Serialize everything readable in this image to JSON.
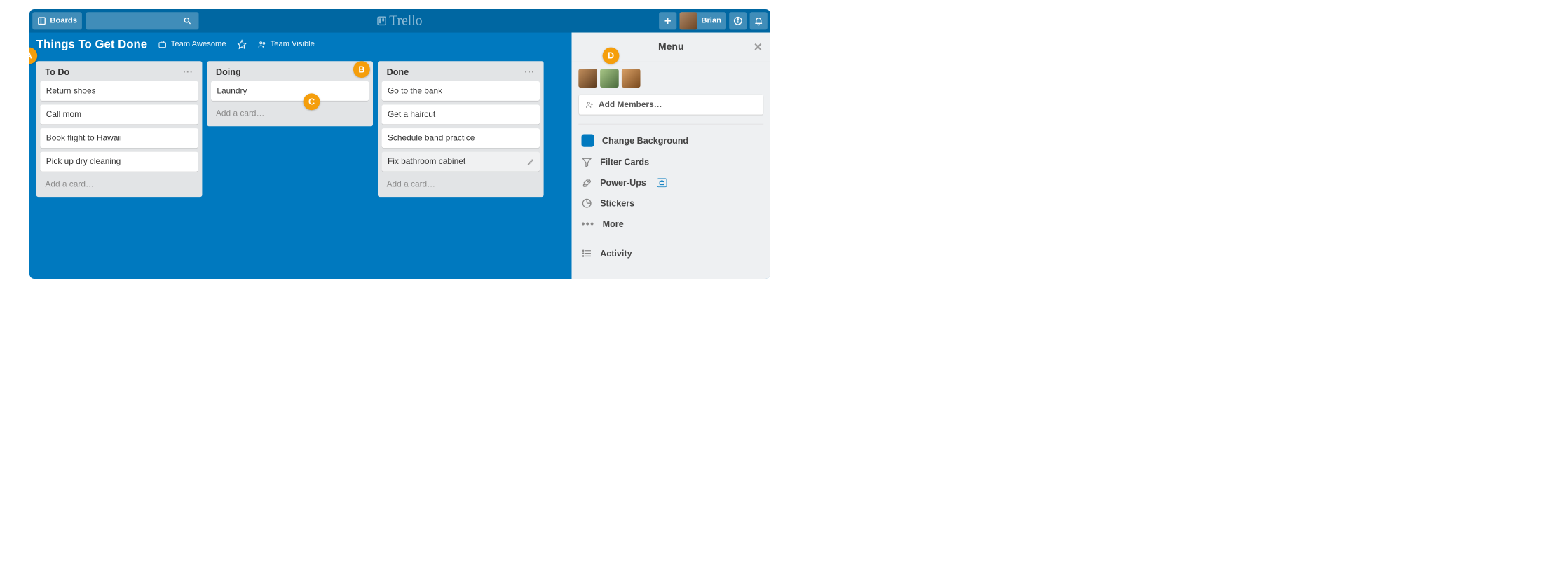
{
  "header": {
    "boards_label": "Boards",
    "user_name": "Brian",
    "logo_text": "Trello"
  },
  "board": {
    "title": "Things To Get Done",
    "team_label": "Team Awesome",
    "visibility_label": "Team Visible"
  },
  "lists": [
    {
      "title": "To Do",
      "cards": [
        "Return shoes",
        "Call mom",
        "Book flight to Hawaii",
        "Pick up dry cleaning"
      ],
      "add_label": "Add a card…"
    },
    {
      "title": "Doing",
      "cards": [
        "Laundry"
      ],
      "add_label": "Add a card…"
    },
    {
      "title": "Done",
      "cards": [
        "Go to the bank",
        "Get a haircut",
        "Schedule band practice",
        "Fix bathroom cabinet"
      ],
      "hover_index": 3,
      "add_label": "Add a card…"
    }
  ],
  "menu": {
    "title": "Menu",
    "add_members_label": "Add Members…",
    "items": {
      "change_bg": "Change Background",
      "filter": "Filter Cards",
      "powerups": "Power-Ups",
      "stickers": "Stickers",
      "more": "More",
      "activity": "Activity"
    }
  },
  "callouts": {
    "a": "A",
    "b": "B",
    "c": "C",
    "d": "D"
  },
  "colors": {
    "brand": "#0079bf",
    "list_bg": "#e2e4e6",
    "callout": "#f59e0b"
  }
}
